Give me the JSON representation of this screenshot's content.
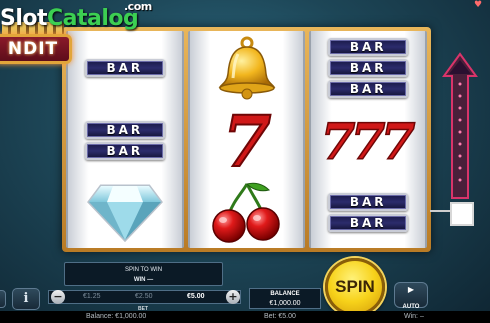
{
  "watermark": {
    "part1": "Slot",
    "part2": "Catalog",
    "suffix": ".com"
  },
  "logo": {
    "text": "NDIT"
  },
  "reels": [
    [
      "BAR",
      "BAR_BAR",
      "DIAMOND"
    ],
    [
      "BELL",
      "SEVEN",
      "CHERRY"
    ],
    [
      "BAR_BAR_BAR",
      "SEVEN_SEVEN_SEVEN",
      "BAR_BAR"
    ]
  ],
  "symbols": {
    "bar": "BAR",
    "bell_icon": "bell-icon",
    "seven": "7",
    "cherry_icon": "cherry-icon",
    "diamond_icon": "diamond-icon"
  },
  "message": {
    "line1": "SPIN TO WIN",
    "line2": "WIN —"
  },
  "bet": {
    "options": [
      "€1.25",
      "€2.50",
      "€5.00"
    ],
    "selected": "€5.00",
    "label": "BET",
    "minus": "−",
    "plus": "+"
  },
  "info_button": {
    "label": "i"
  },
  "balance": {
    "title": "BALANCE",
    "value": "€1,000.00"
  },
  "spin_button": {
    "label": "SPIN"
  },
  "auto_button": {
    "label": "AUTO",
    "icon": "▶"
  },
  "status_bar": {
    "balance": "Balance: €1,000.00",
    "bet": "Bet: €5.00",
    "win": "Win: –"
  },
  "colors": {
    "frame_gold": "#e9b65a",
    "bar_navy": "#1b1b4a",
    "seven_red": "#d01818",
    "spin_yellow": "#f7d21a"
  }
}
